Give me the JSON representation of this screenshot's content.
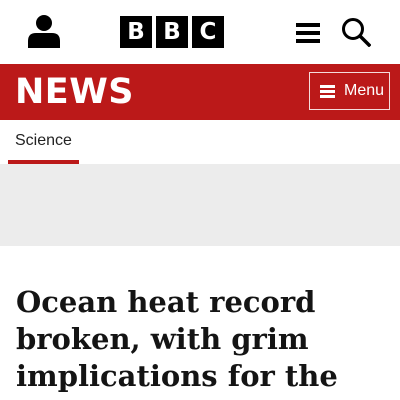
{
  "header": {
    "account_icon": "person-icon",
    "logo_letters": [
      "B",
      "B",
      "C"
    ],
    "menu_icon": "hamburger-icon",
    "search_icon": "magnifier-icon"
  },
  "news_bar": {
    "title": "NEWS",
    "menu_button_label": "Menu",
    "menu_button_icon": "hamburger-icon"
  },
  "subnav": {
    "tabs": [
      {
        "label": "Science",
        "selected": true
      }
    ]
  },
  "article": {
    "headline": "Ocean heat record broken, with grim implications for the"
  },
  "colors": {
    "brand_red": "#bb1919",
    "logo_black": "#000000",
    "ad_background": "#ececec",
    "headline_text": "#141414"
  }
}
